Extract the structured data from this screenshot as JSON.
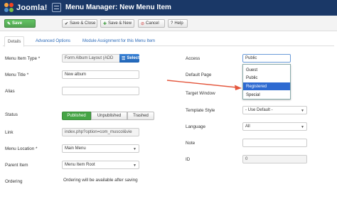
{
  "header": {
    "logo": "Joomla!",
    "title": "Menu Manager: New Menu Item"
  },
  "toolbar": {
    "save": "Save",
    "save_close": "Save & Close",
    "save_new": "Save & New",
    "cancel": "Cancel",
    "help": "Help"
  },
  "tabs": [
    "Details",
    "Advanced Options",
    "Module Assignment for this Menu Item"
  ],
  "form": {
    "menu_item_type_label": "Menu Item Type *",
    "menu_item_type_value": "Form Album Layout (ADD",
    "select_button": "Select",
    "menu_title_label": "Menu Title *",
    "menu_title_value": "New album",
    "alias_label": "Alias",
    "alias_value": "",
    "status_label": "Status",
    "status_options": [
      "Published",
      "Unpublished",
      "Trashed"
    ],
    "link_label": "Link",
    "link_value": "index.php?option=com_muscol&vie",
    "menu_location_label": "Menu Location *",
    "menu_location_value": "Main Menu",
    "parent_item_label": "Parent Item",
    "parent_item_value": "Menu Item Root",
    "ordering_label": "Ordering",
    "ordering_value": "Ordering will be available after saving"
  },
  "right": {
    "access_label": "Access",
    "access_value": "Public",
    "access_options": [
      "Guest",
      "Public",
      "Registered",
      "Special"
    ],
    "access_selected": "Registered",
    "default_page_label": "Default Page",
    "target_window_label": "Target Window",
    "template_style_label": "Template Style",
    "template_style_value": "- Use Default -",
    "language_label": "Language",
    "language_value": "All",
    "note_label": "Note",
    "note_value": "",
    "id_label": "ID",
    "id_value": "0"
  },
  "colors": {
    "header_bg": "#1a3867",
    "save_green": "#51a351",
    "published_green": "#46a546",
    "select_blue": "#1f63b5",
    "highlight_blue": "#2e6ad1",
    "annotation_red": "#e4573d"
  }
}
